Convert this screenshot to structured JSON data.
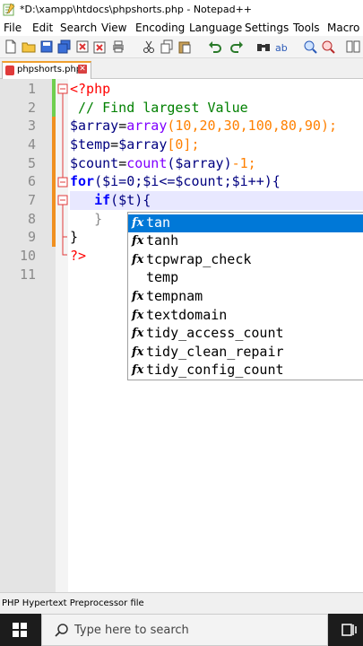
{
  "window": {
    "title": "*D:\\xampp\\htdocs\\phpshorts.php - Notepad++"
  },
  "menu": [
    "File",
    "Edit",
    "Search",
    "View",
    "Encoding",
    "Language",
    "Settings",
    "Tools",
    "Macro"
  ],
  "tab": {
    "label": "phpshorts.php",
    "close": "✕"
  },
  "lines": [
    "1",
    "2",
    "3",
    "4",
    "5",
    "6",
    "7",
    "8",
    "9",
    "10",
    "11"
  ],
  "code": {
    "l1": "<?php",
    "l2": "// Find largest Value",
    "l3_var": "$array",
    "l3_eq": "=",
    "l3_fn": "array",
    "l3_args": "(10,20,30,100,80,90);",
    "l4_var": "$temp",
    "l4_eq": "=",
    "l4_var2": "$array",
    "l4_rest": "[0];",
    "l5_var": "$count",
    "l5_eq": "=",
    "l5_fn": "count",
    "l5_arg": "($array)",
    "l5_rest": "-1;",
    "l6_kw": "for",
    "l6_rest": "($i=0;$i<=$count;$i++){",
    "l7_kw": "if",
    "l7_rest": "($t){",
    "l8": "}",
    "l9": "}",
    "l10": "?>"
  },
  "autocomplete": [
    {
      "label": "tan",
      "icon": "function-icon",
      "selected": true
    },
    {
      "label": "tanh",
      "icon": "function-icon",
      "selected": false
    },
    {
      "label": "tcpwrap_check",
      "icon": "function-icon",
      "selected": false
    },
    {
      "label": "temp",
      "icon": "",
      "selected": false
    },
    {
      "label": "tempnam",
      "icon": "function-icon",
      "selected": false
    },
    {
      "label": "textdomain",
      "icon": "function-icon",
      "selected": false
    },
    {
      "label": "tidy_access_count",
      "icon": "function-icon",
      "selected": false
    },
    {
      "label": "tidy_clean_repair",
      "icon": "function-icon",
      "selected": false
    },
    {
      "label": "tidy_config_count",
      "icon": "function-icon",
      "selected": false
    }
  ],
  "fx_glyph": "fx",
  "status": {
    "language": "PHP Hypertext Preprocessor file"
  },
  "taskbar": {
    "search_placeholder": "Type here to search"
  },
  "colors": {
    "selection": "#0078d7",
    "taskbar": "#1c1c1c",
    "php_keyword": "#0000ff",
    "php_number": "#ff8000",
    "comment": "#008000"
  }
}
